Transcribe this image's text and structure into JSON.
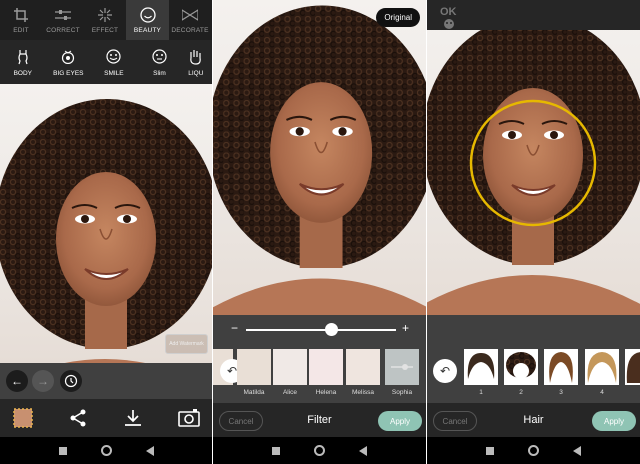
{
  "panel1": {
    "tabs": [
      {
        "label": "EDIT",
        "icon": "crop-icon"
      },
      {
        "label": "CORRECT",
        "icon": "sliders-icon"
      },
      {
        "label": "EFFECT",
        "icon": "sparkle-icon"
      },
      {
        "label": "BEAUTY",
        "icon": "smile-face-icon"
      },
      {
        "label": "DECORATE",
        "icon": "bowtie-icon"
      }
    ],
    "active_tab": "BEAUTY",
    "tools": [
      {
        "label": "BODY",
        "icon": "body-icon"
      },
      {
        "label": "BIG EYES",
        "icon": "eye-icon"
      },
      {
        "label": "SMILE",
        "icon": "smile-icon"
      },
      {
        "label": "Slim",
        "icon": "slim-face-icon"
      },
      {
        "label": "LIQU",
        "icon": "hand-icon"
      }
    ],
    "watermark": "Add Watermark",
    "bottom_icons": [
      "thumbnail-icon",
      "share-icon",
      "download-icon",
      "camera-icon"
    ]
  },
  "panel2": {
    "original_label": "Original",
    "slider_value": 0.57,
    "filters": [
      "Matilda",
      "Alice",
      "Helena",
      "Melissa",
      "Sophia"
    ],
    "title": "Filter",
    "cancel_label": "Cancel",
    "apply_label": "Apply"
  },
  "panel3": {
    "ok_label": "OK",
    "hair_items": [
      "1",
      "2",
      "3",
      "4"
    ],
    "title": "Hair",
    "cancel_label": "Cancel",
    "apply_label": "Apply"
  },
  "colors": {
    "accent": "#8fc4b4",
    "ring": "#e6b800",
    "toolbar": "#262626",
    "strip": "#404040"
  }
}
